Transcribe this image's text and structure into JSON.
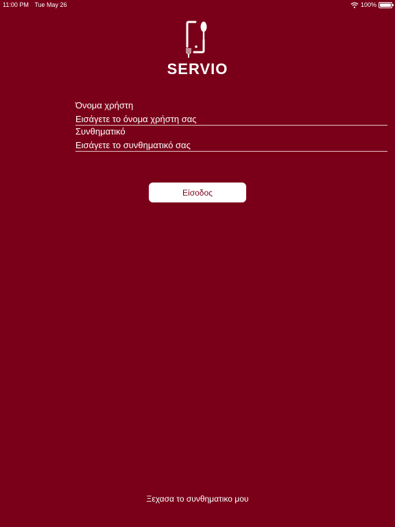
{
  "status_bar": {
    "time": "11:00 PM",
    "date": "Tue May 26",
    "battery_label": "100%",
    "battery_level": 1.0
  },
  "app": {
    "logo_text": "SERVIO"
  },
  "login_form": {
    "username_label": "Όνομα χρήστη",
    "username_placeholder": "Εισάγετε το όνομα χρήστη σας",
    "password_label": "Συνθηματικό",
    "password_placeholder": "Εισάγετε το συνθηματικό σας",
    "submit_label": "Είσοδος"
  },
  "forgot_password_label": "Ξεχασα το συνθηματικο μου",
  "colors": {
    "background": "#7a0019",
    "foreground": "#ffffff"
  }
}
